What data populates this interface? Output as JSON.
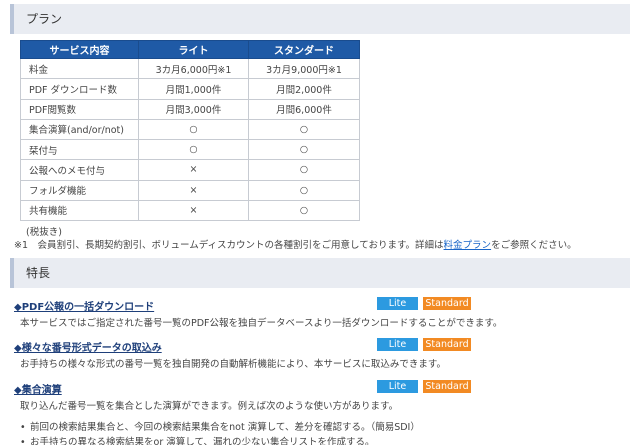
{
  "plan": {
    "heading": "プラン",
    "columns": [
      "サービス内容",
      "ライト",
      "スタンダード"
    ],
    "rows": [
      [
        "料金",
        "3カ月6,000円※1",
        "3カ月9,000円※1"
      ],
      [
        "PDF ダウンロード数",
        "月間1,000件",
        "月間2,000件"
      ],
      [
        "PDF閲覧数",
        "月間3,000件",
        "月間6,000件"
      ],
      [
        "集合演算(and/or/not)",
        "○",
        "○"
      ],
      [
        "栞付与",
        "○",
        "○"
      ],
      [
        "公報へのメモ付与",
        "×",
        "○"
      ],
      [
        "フォルダ機能",
        "×",
        "○"
      ],
      [
        "共有機能",
        "×",
        "○"
      ]
    ],
    "tax_note": "(税抜き)",
    "discount_prefix": "※1　会員割引、長期契約割引、ボリュームディスカウントの各種割引をご用意しております。詳細は",
    "discount_link": "料金プラン",
    "discount_suffix": "をご参照ください。"
  },
  "features": {
    "heading": "特長",
    "badges": {
      "lite": "Lite",
      "standard": "Standard"
    },
    "items": [
      {
        "title": "◆PDF公報の一括ダウンロード",
        "desc": "本サービスではご指定された番号一覧のPDF公報を独自データベースより一括ダウンロードすることができます。"
      },
      {
        "title": "◆様々な番号形式データの取込み",
        "desc": "お手持ちの様々な形式の番号一覧を独自開発の自動解析機能により、本サービスに取込みできます。"
      },
      {
        "title": "◆集合演算",
        "desc": "取り込んだ番号一覧を集合とした演算ができます。例えば次のような使い方があります。"
      }
    ],
    "uses": [
      "前回の検索結果集合と、今回の検索結果集合をnot 演算して、差分を確認する。（簡易SDI）",
      "お手持ちの異なる検索結果をor 演算して、漏れの少ない集合リストを作成する。"
    ]
  }
}
